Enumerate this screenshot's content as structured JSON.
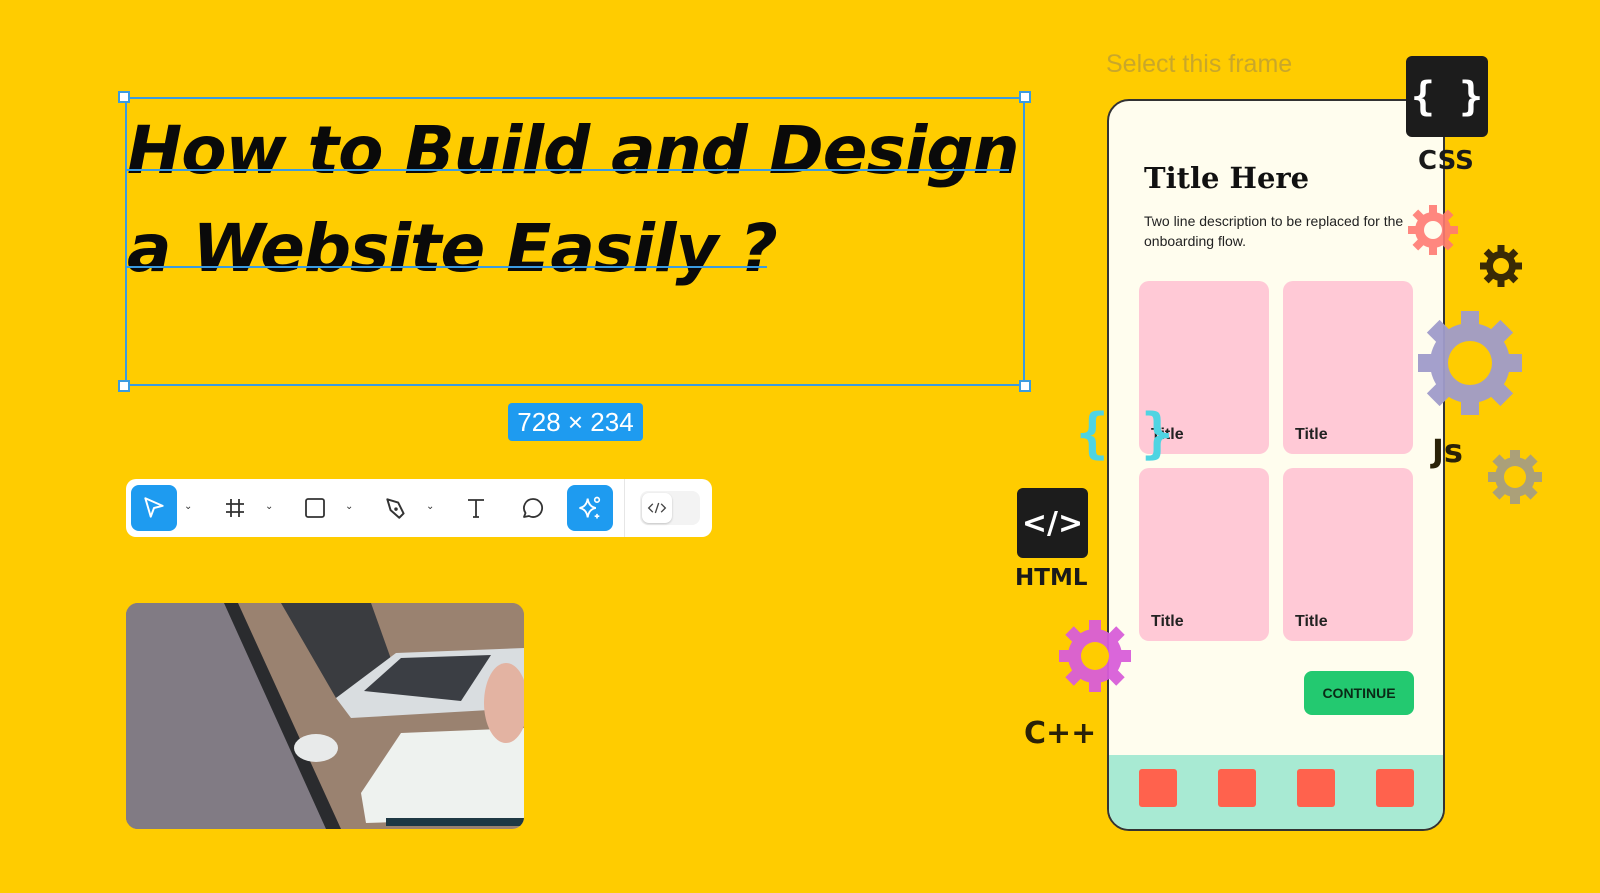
{
  "canvas": {
    "background": "#FFCC00",
    "headline": {
      "line1": "How to Build and Design",
      "line2": "a Website Easily ?"
    },
    "selection_size": "728 × 234",
    "selection_color": "#3b9be0"
  },
  "toolbar": {
    "tools": [
      {
        "name": "move",
        "icon": "cursor-icon",
        "active": true,
        "has_dropdown": true
      },
      {
        "name": "frame",
        "icon": "frame-hash-icon",
        "active": false,
        "has_dropdown": true
      },
      {
        "name": "shape",
        "icon": "rectangle-icon",
        "active": false,
        "has_dropdown": true
      },
      {
        "name": "pen",
        "icon": "pen-icon",
        "active": false,
        "has_dropdown": true
      },
      {
        "name": "text",
        "icon": "text-icon",
        "active": false,
        "has_dropdown": false
      },
      {
        "name": "comment",
        "icon": "comment-icon",
        "active": false,
        "has_dropdown": false
      },
      {
        "name": "ai",
        "icon": "sparkle-icon",
        "active": true,
        "has_dropdown": false
      }
    ],
    "dev_mode_icon": "code-icon",
    "accent": "#1e9bf0"
  },
  "mockup": {
    "frame_label": "Select this frame",
    "title": "Title Here",
    "description": "Two line description to be replaced for the onboarding flow.",
    "cards": [
      "Title",
      "Title",
      "Title",
      "Title"
    ],
    "continue_label": "CONTINUE",
    "nav_items": 4,
    "colors": {
      "card": "#ffc9d6",
      "button": "#23c970",
      "nav": "#a8ead3",
      "nav_item": "#ff624d",
      "bg": "#fffdee"
    }
  },
  "tech": {
    "css": {
      "glyph": "{ }",
      "label": "CSS"
    },
    "html": {
      "glyph": "</>",
      "label": "HTML"
    },
    "js": {
      "label": "Js"
    },
    "cpp": {
      "label": "C++"
    },
    "braces": "{ }"
  }
}
